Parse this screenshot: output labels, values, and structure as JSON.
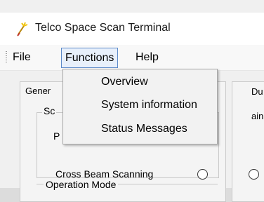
{
  "window": {
    "title": "Telco Space Scan Terminal"
  },
  "menubar": {
    "items": [
      "File",
      "Functions",
      "Help"
    ]
  },
  "dropdown": {
    "items": [
      "Overview",
      "System information",
      "Status Messages"
    ]
  },
  "form": {
    "tab_left": "Gener",
    "tab_right": "Du",
    "tab_right_sub": "ain",
    "group_scan_label": "Sc",
    "row_p_label": "P",
    "cross_beam_label": "Cross Beam Scanning",
    "operation_mode_label": "Operation Mode"
  },
  "colors": {
    "menu_highlight_border": "#5d8ac9",
    "menu_highlight_fill": "#e8f0fb"
  }
}
